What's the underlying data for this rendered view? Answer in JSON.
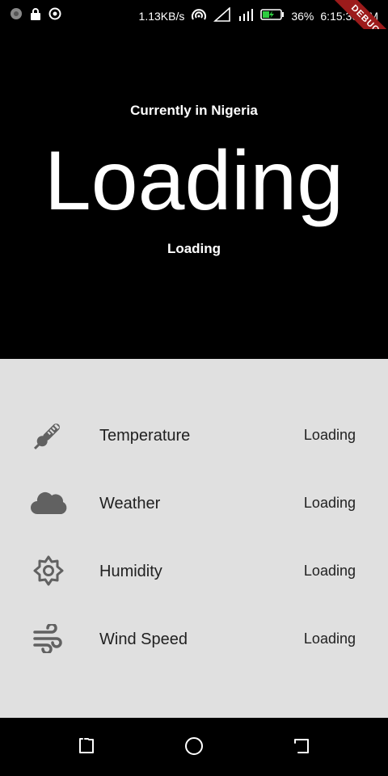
{
  "status_bar": {
    "speed": "1.13KB/s",
    "battery": "36%",
    "time": "6:15:30 PM",
    "debug": "DEBUG"
  },
  "header": {
    "location": "Currently in Nigeria",
    "temperature": "Loading",
    "description": "Loading"
  },
  "details": [
    {
      "icon": "thermometer-icon",
      "label": "Temperature",
      "value": "Loading"
    },
    {
      "icon": "cloud-icon",
      "label": "Weather",
      "value": "Loading"
    },
    {
      "icon": "sun-icon",
      "label": "Humidity",
      "value": "Loading"
    },
    {
      "icon": "wind-icon",
      "label": "Wind Speed",
      "value": "Loading"
    }
  ],
  "colors": {
    "header_bg": "#000000",
    "details_bg": "#e0e0e0",
    "icon": "#616161",
    "debug_ribbon": "#9c1b1b"
  }
}
